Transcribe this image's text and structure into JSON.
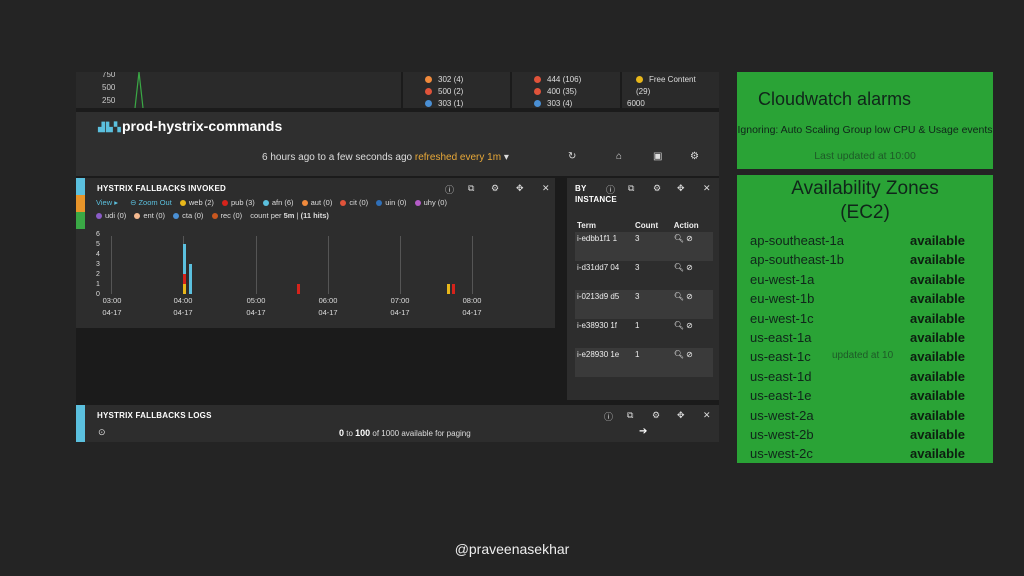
{
  "top": {
    "yticks": [
      "750",
      "500",
      "250"
    ],
    "legend": [
      {
        "label": "302 (4)",
        "color": "#f08a3c"
      },
      {
        "label": "500 (2)",
        "color": "#e0533a"
      },
      {
        "label": "303 (1)",
        "color": "#4a8fd4"
      },
      {
        "label": "444 (106)",
        "color": "#e0533a"
      },
      {
        "label": "400 (35)",
        "color": "#e0533a"
      },
      {
        "label": "303 (4)",
        "color": "#4a8fd4"
      },
      {
        "label": "Free Content",
        "color": "#e8b71a"
      },
      {
        "label": "(29)",
        "color": ""
      },
      {
        "label": "6000",
        "color": ""
      }
    ]
  },
  "dashboard": {
    "title": "prod-hystrix-commands",
    "timefilter": "6 hours ago to a few seconds ago",
    "refresh": "refreshed every 1m",
    "caret": "▾",
    "icons": [
      "refresh-icon",
      "home-icon",
      "save-icon",
      "settings-icon"
    ]
  },
  "fallbacks_invoked": {
    "title": "HYSTRIX FALLBACKS INVOKED",
    "view": "View ▸",
    "zoom_out": "Zoom Out",
    "legend": [
      {
        "label": "web (2)",
        "color": "#e8b71a"
      },
      {
        "label": "pub (3)",
        "color": "#d6231b"
      },
      {
        "label": "afn (6)",
        "color": "#5bc0de"
      },
      {
        "label": "aut (0)",
        "color": "#f08a3c"
      },
      {
        "label": "cit (0)",
        "color": "#e0533a"
      },
      {
        "label": "uin (0)",
        "color": "#2f6fb8"
      },
      {
        "label": "uhy (0)",
        "color": "#b45cc7"
      },
      {
        "label": "udi (0)",
        "color": "#8a5cc7"
      },
      {
        "label": "ent (0)",
        "color": "#f5b98f"
      },
      {
        "label": "cta (0)",
        "color": "#4a8fd4"
      },
      {
        "label": "rec (0)",
        "color": "#c9571f"
      }
    ],
    "count_per_prefix": "count per ",
    "count_per_interval": "5m",
    "count_hits": "(11 hits)",
    "yticks": [
      "6",
      "5",
      "4",
      "3",
      "2",
      "1",
      "0"
    ],
    "xticks": [
      {
        "time": "03:00",
        "date": "04-17"
      },
      {
        "time": "04:00",
        "date": "04-17"
      },
      {
        "time": "05:00",
        "date": "04-17"
      },
      {
        "time": "06:00",
        "date": "04-17"
      },
      {
        "time": "07:00",
        "date": "04-17"
      },
      {
        "time": "08:00",
        "date": "04-17"
      }
    ]
  },
  "by_instance": {
    "title_line1": "BY",
    "title_line2": "INSTANCE",
    "headers": [
      "Term",
      "Count",
      "Action"
    ],
    "rows": [
      {
        "term": "i-edbb1f1 1",
        "count": "3"
      },
      {
        "term": "i-d31dd7 04",
        "count": "3"
      },
      {
        "term": "i-0213d9 d5",
        "count": "3"
      },
      {
        "term": "i-e38930 1f",
        "count": "1"
      },
      {
        "term": "i-e28930 1e",
        "count": "1"
      }
    ]
  },
  "fallbacks_logs": {
    "title": "HYSTRIX FALLBACKS LOGS",
    "paging_from": "0",
    "paging_to": "100",
    "paging_text": "of 1000 available for paging"
  },
  "cloudwatch": {
    "title": "Cloudwatch alarms",
    "subtitle": "Ignoring: Auto Scaling Group low CPU & Usage events",
    "updated": "Last updated at 10:00"
  },
  "availability": {
    "title_line1": "Availability Zones",
    "title_line2": "(EC2)",
    "overlay": "updated at 10",
    "zones": [
      {
        "name": "ap-southeast-1a",
        "status": "available"
      },
      {
        "name": "ap-southeast-1b",
        "status": "available"
      },
      {
        "name": "eu-west-1a",
        "status": "available"
      },
      {
        "name": "eu-west-1b",
        "status": "available"
      },
      {
        "name": "eu-west-1c",
        "status": "available"
      },
      {
        "name": "us-east-1a",
        "status": "available"
      },
      {
        "name": "us-east-1c",
        "status": "available"
      },
      {
        "name": "us-east-1d",
        "status": "available"
      },
      {
        "name": "us-east-1e",
        "status": "available"
      },
      {
        "name": "us-west-2a",
        "status": "available"
      },
      {
        "name": "us-west-2b",
        "status": "available"
      },
      {
        "name": "us-west-2c",
        "status": "available"
      }
    ]
  },
  "footer": "@praveenasekhar"
}
